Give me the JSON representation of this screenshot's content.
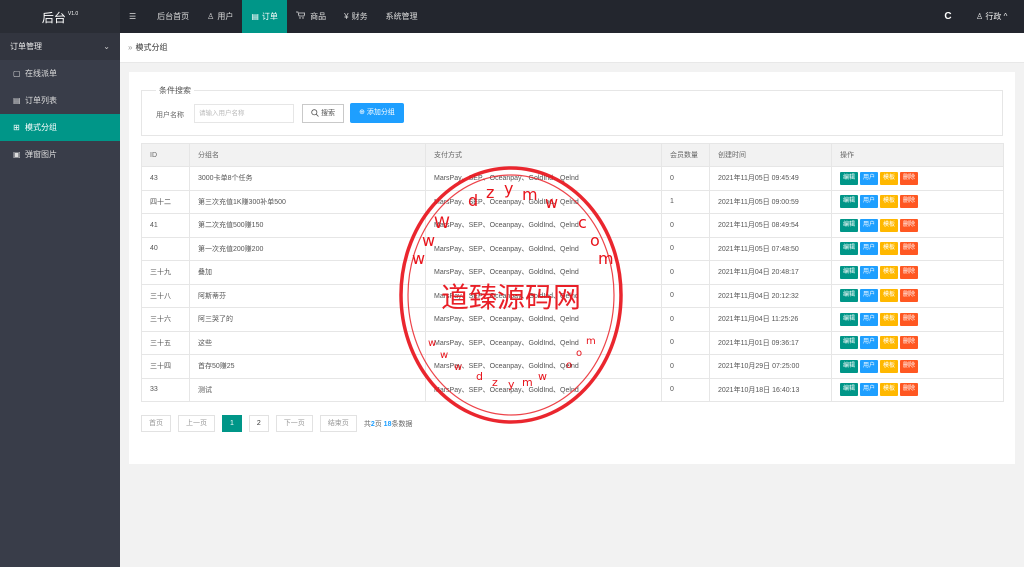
{
  "app": {
    "logo": "后台",
    "version": "V1.0"
  },
  "topnav": [
    {
      "icon": "menu-icon",
      "glyph": "☰",
      "label": ""
    },
    {
      "icon": "",
      "glyph": "",
      "label": "后台首页"
    },
    {
      "icon": "user-icon",
      "glyph": "♙",
      "label": "用户"
    },
    {
      "icon": "order-icon",
      "glyph": "▤",
      "label": "订单"
    },
    {
      "icon": "cart-icon",
      "glyph": "🛒",
      "label": "商品"
    },
    {
      "icon": "yen-icon",
      "glyph": "¥",
      "label": "财务"
    },
    {
      "icon": "",
      "glyph": "",
      "label": "系统管理"
    }
  ],
  "topright": {
    "refresh_glyph": "C",
    "user_label": "行政",
    "user_glyph": "♙",
    "caret": "^"
  },
  "sidebar": {
    "group": "订单管理",
    "items": [
      {
        "label": "在线派单",
        "glyph": "▢"
      },
      {
        "label": "订单列表",
        "glyph": "▤"
      },
      {
        "label": "模式分组",
        "glyph": "⊞"
      },
      {
        "label": "弹窗图片",
        "glyph": "▣"
      }
    ]
  },
  "breadcrumb": {
    "sep": "»",
    "label": "模式分组"
  },
  "search": {
    "legend": "条件搜索",
    "user_label": "用户名称",
    "placeholder": "请输入用户名称",
    "search_button": "搜索",
    "add_button": "添加分组"
  },
  "table": {
    "headers": [
      "ID",
      "分组名",
      "支付方式",
      "会员数量",
      "创建时间",
      "操作"
    ],
    "rows": [
      [
        "43",
        "3000卡单8个任务",
        "MarsPay、SEP、Oceanpay、GoldInd、Qelnd",
        "0",
        "2021年11月05日 09:45:49"
      ],
      [
        "四十二",
        "第三次充值1K赚300补单500",
        "MarsPay、SEP、Oceanpay、GoldInd、Qelnd",
        "1",
        "2021年11月05日 09:00:59"
      ],
      [
        "41",
        "第二次充值500赚150",
        "MarsPay、SEP、Oceanpay、GoldInd、Qelnd",
        "0",
        "2021年11月05日 08:49:54"
      ],
      [
        "40",
        "第一次充值200赚200",
        "MarsPay、SEP、Oceanpay、GoldInd、Qelnd",
        "0",
        "2021年11月05日 07:48:50"
      ],
      [
        "三十九",
        "叠加",
        "MarsPay、SEP、Oceanpay、GoldInd、Qelnd",
        "0",
        "2021年11月04日 20:48:17"
      ],
      [
        "三十八",
        "阿斯蒂芬",
        "MarsPay、SEP、Oceanpay、GoldInd、Qelnd",
        "0",
        "2021年11月04日 20:12:32"
      ],
      [
        "三十六",
        "阿三哭了的",
        "MarsPay、SEP、Oceanpay、GoldInd、Qelnd",
        "0",
        "2021年11月04日 11:25:26"
      ],
      [
        "三十五",
        "这些",
        "MarsPay、SEP、Oceanpay、GoldInd、Qelnd",
        "0",
        "2021年11月01日 09:36:17"
      ],
      [
        "三十四",
        "首存50赚25",
        "MarsPay、SEP、Oceanpay、GoldInd、Qelnd",
        "0",
        "2021年10月29日 07:25:00"
      ],
      [
        "33",
        "测试",
        "MarsPay、SEP、Oceanpay、GoldInd、Qelnd",
        "0",
        "2021年10月18日 16:40:13"
      ]
    ],
    "actions": {
      "edit": "编辑",
      "user": "用户",
      "template": "模板",
      "delete": "删除"
    }
  },
  "pager": {
    "first": "首页",
    "prev": "上一页",
    "pages": [
      "1",
      "2"
    ],
    "next": "下一页",
    "last": "结束页",
    "info_prefix": "共",
    "total_pages": "2",
    "info_mid": "页",
    "total_records": "18",
    "info_suffix": "条数据"
  },
  "watermark": {
    "text": "道臻源码网",
    "ring_text": "www.dzym.com"
  },
  "colors": {
    "accent": "#009688",
    "blue": "#1e9fff",
    "orange": "#ffb800",
    "red": "#ff5722",
    "topbar": "#23262e",
    "sidebar": "#393d49"
  }
}
